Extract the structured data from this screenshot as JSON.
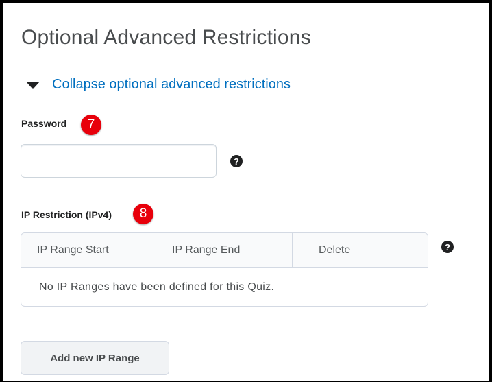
{
  "section": {
    "title": "Optional Advanced Restrictions",
    "collapse_link": "Collapse optional advanced restrictions"
  },
  "password": {
    "label": "Password",
    "badge": "7",
    "value": "",
    "help_icon": "question-circle-icon"
  },
  "ip_restriction": {
    "label": "IP Restriction (IPv4)",
    "badge": "8",
    "help_icon": "question-circle-icon",
    "table": {
      "columns": [
        "IP Range Start",
        "IP Range End",
        "Delete"
      ],
      "empty_message": "No IP Ranges have been defined for this Quiz."
    },
    "add_button": "Add new IP Range"
  },
  "colors": {
    "link": "#006fbf",
    "badge": "#e8000b",
    "text": "#494c4e",
    "border": "#d3d9e3"
  }
}
